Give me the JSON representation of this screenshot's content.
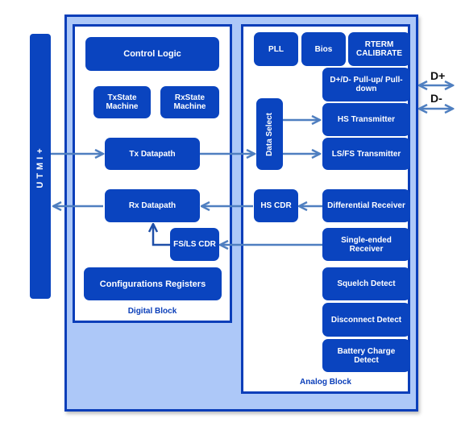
{
  "diagram": {
    "interface_bus": {
      "label": "UTMI+"
    },
    "digital_block": {
      "label": "Digital Block",
      "blocks": {
        "control_logic": "Control Logic",
        "tx_state_machine": "TxState Machine",
        "rx_state_machine": "RxState Machine",
        "tx_datapath": "Tx Datapath",
        "rx_datapath": "Rx Datapath",
        "fs_ls_cdr": "FS/LS CDR",
        "config_registers": "Configurations Registers"
      }
    },
    "analog_block": {
      "label": "Analog Block",
      "blocks": {
        "pll": "PLL",
        "bios": "Bios",
        "rterm_calibrate": "RTERM CALIBRATE",
        "pull_up_down": "D+/D- Pull-up/ Pull-down",
        "data_select": "Data Select",
        "hs_transmitter": "HS Transmitter",
        "ls_fs_transmitter": "LS/FS Transmitter",
        "hs_cdr": "HS CDR",
        "differential_receiver": "Differential Receiver",
        "single_ended_receiver": "Single-ended Receiver",
        "squelch_detect": "Squelch Detect",
        "disconnect_detect": "Disconnect Detect",
        "battery_charge_detect": "Battery Charge Detect"
      }
    },
    "signals": {
      "d_plus": "D+",
      "d_minus": "D-"
    },
    "colors": {
      "block_fill": "#0a44bf",
      "border": "#0a3eb9",
      "outer_fill": "#adc8f8",
      "wire": "#4f7fc0"
    }
  }
}
